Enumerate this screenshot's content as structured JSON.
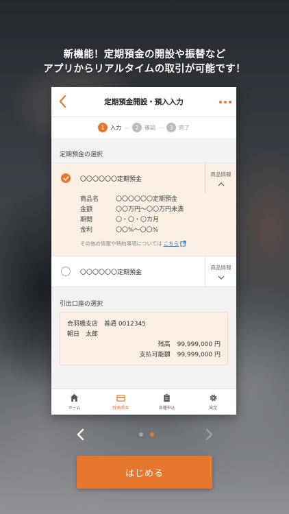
{
  "headline": {
    "line1": "新機能！定期預金の開設や振替など",
    "line2": "アプリからリアルタイムの取引が可能です！"
  },
  "screen": {
    "title": "定期預金開設・預入入力",
    "steps": [
      {
        "num": "1",
        "label": "入力"
      },
      {
        "num": "2",
        "label": "確認"
      },
      {
        "num": "3",
        "label": "完了"
      }
    ],
    "step_separator": "—",
    "product_section_title": "定期預金の選択",
    "products": [
      {
        "name": "〇〇〇〇〇〇定期預金",
        "info_label": "商品情報",
        "details": [
          {
            "key": "商品名",
            "value": "〇〇〇〇〇〇定期預金"
          },
          {
            "key": "金額",
            "value": "〇〇万円〜〇〇万円未満"
          },
          {
            "key": "期間",
            "value": "〇・〇・〇カ月"
          },
          {
            "key": "金利",
            "value": "〇〇%〜〇〇%"
          }
        ],
        "note_text": "その他の情報や特約事項については",
        "note_link": "こちら"
      },
      {
        "name": "〇〇〇〇〇〇定期預金",
        "info_label": "商品情報"
      }
    ],
    "account_section_title": "引出口座の選択",
    "account": {
      "branch_line": "合羽橋支店　普通 0012345",
      "holder": "朝日　太郎",
      "balance_label": "残高",
      "balance_value": "99,999,000 円",
      "available_label": "支払可能額",
      "available_value": "99,999,000 円"
    },
    "tabs": [
      {
        "label": "ホーム",
        "icon": "home-icon"
      },
      {
        "label": "残高照会",
        "icon": "card-icon"
      },
      {
        "label": "各種申込",
        "icon": "clipboard-icon"
      },
      {
        "label": "設定",
        "icon": "gear-icon"
      }
    ]
  },
  "start_button": "はじめる",
  "colors": {
    "accent": "#e8772e",
    "link": "#2b7bd4",
    "selected_bg": "#fcefe4"
  }
}
